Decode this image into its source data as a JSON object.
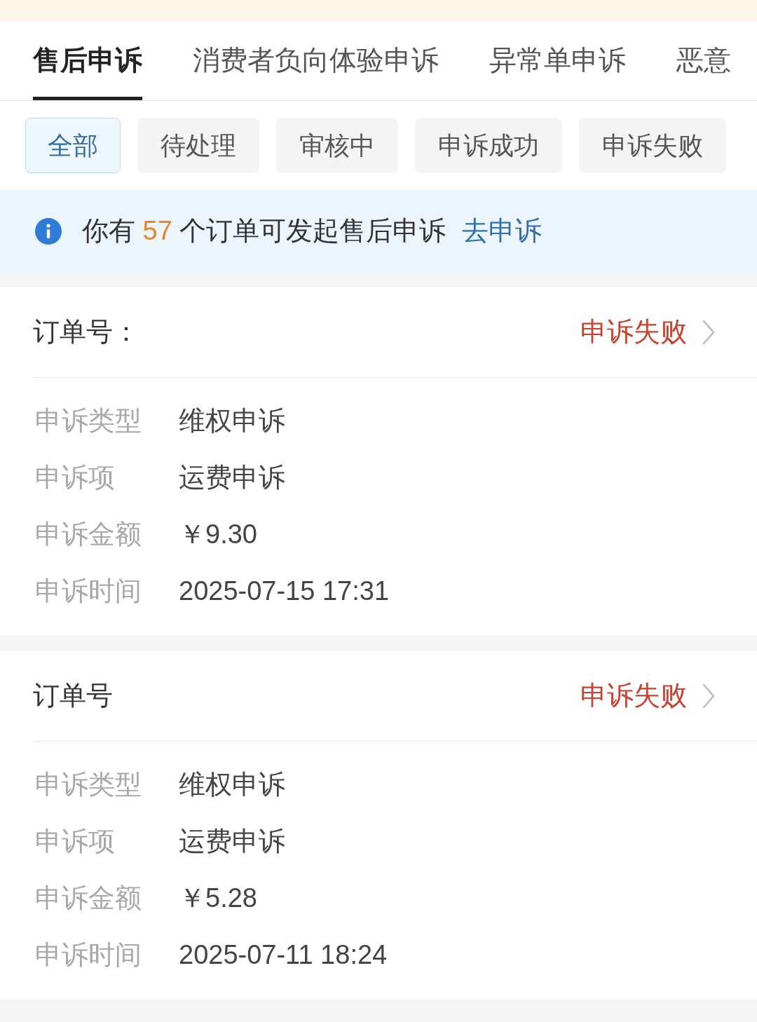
{
  "tabs": [
    {
      "label": "售后申诉",
      "selected": true
    },
    {
      "label": "消费者负向体验申诉",
      "selected": false
    },
    {
      "label": "异常单申诉",
      "selected": false
    },
    {
      "label": "恶意",
      "selected": false
    }
  ],
  "filters": [
    {
      "label": "全部",
      "selected": true
    },
    {
      "label": "待处理",
      "selected": false
    },
    {
      "label": "审核中",
      "selected": false
    },
    {
      "label": "申诉成功",
      "selected": false
    },
    {
      "label": "申诉失败",
      "selected": false
    }
  ],
  "notice": {
    "text_before": "你有",
    "count": "57",
    "text_after": "个订单可发起售后申诉",
    "link": "去申诉"
  },
  "cards": [
    {
      "order_label": "订单号：",
      "status": "申诉失败",
      "fields": [
        {
          "label": "申诉类型",
          "value": "维权申诉"
        },
        {
          "label": "申诉项",
          "value": "运费申诉"
        },
        {
          "label": "申诉金额",
          "value": "￥9.30"
        },
        {
          "label": "申诉时间",
          "value": "2025-07-15 17:31"
        }
      ]
    },
    {
      "order_label": "订单号",
      "status": "申诉失败",
      "fields": [
        {
          "label": "申诉类型",
          "value": "维权申诉"
        },
        {
          "label": "申诉项",
          "value": "运费申诉"
        },
        {
          "label": "申诉金额",
          "value": "￥5.28"
        },
        {
          "label": "申诉时间",
          "value": "2025-07-11 18:24"
        }
      ]
    }
  ]
}
